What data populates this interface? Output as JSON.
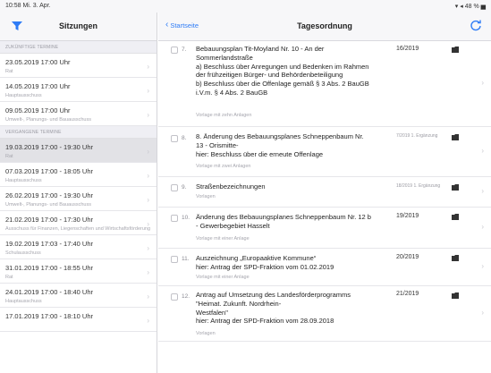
{
  "status_bar": {
    "time": "10:58  Mi. 3. Apr.",
    "right": "▾ ◂ 48 % ▅"
  },
  "sidebar": {
    "title": "Sitzungen",
    "sections": [
      {
        "label": "ZUKÜNFTIGE TERMINE",
        "items": [
          {
            "time": "23.05.2019 17:00 Uhr",
            "body": "Rat",
            "selected": false
          },
          {
            "time": "14.05.2019 17:00 Uhr",
            "body": "Hauptausschuss",
            "selected": false
          },
          {
            "time": "09.05.2019 17:00 Uhr",
            "body": "Umwelt-, Planungs- und Bauausschuss",
            "selected": false
          }
        ]
      },
      {
        "label": "VERGANGENE TERMINE",
        "items": [
          {
            "time": "19.03.2019 17:00 -  19:30 Uhr",
            "body": "Rat",
            "selected": true
          },
          {
            "time": "07.03.2019 17:00 -  18:05 Uhr",
            "body": "Hauptausschuss",
            "selected": false
          },
          {
            "time": "26.02.2019 17:00 -  19:30 Uhr",
            "body": "Umwelt-, Planungs- und Bauausschuss",
            "selected": false
          },
          {
            "time": "21.02.2019 17:00 -  17:30 Uhr",
            "body": "Ausschuss für Finanzen, Liegenschaften und Wirtschaftsförderung",
            "selected": false
          },
          {
            "time": "19.02.2019 17:03 -  17:40 Uhr",
            "body": "Schulausschuss",
            "selected": false
          },
          {
            "time": "31.01.2019 17:00 -  18:55 Uhr",
            "body": "Rat",
            "selected": false
          },
          {
            "time": "24.01.2019 17:00 -  18:40 Uhr",
            "body": "Hauptausschuss",
            "selected": false
          },
          {
            "time": "17.01.2019 17:00 -  18:10 Uhr",
            "body": "",
            "selected": false
          }
        ]
      }
    ]
  },
  "main": {
    "back_label": "Startseite",
    "title": "Tagesordnung",
    "items": [
      {
        "number": "7.",
        "title": "Bebauungsplan Tit-Moyland Nr. 10 - An der Sommerlandstraße\na) Beschluss über Anregungen und Bedenken im Rahmen der frühzeitigen Bürger- und Behördenbeteiligung\nb) Beschluss über die Offenlage gemäß § 3 Abs. 2 BauGB i.V.m. § 4 Abs. 2 BauGB",
        "sub": "Vorlage mit zehn Anlagen",
        "ref": "16/2019",
        "ref_small": false
      },
      {
        "number": "8.",
        "title": "8. Änderung des Bebauungsplanes Schneppenbaum Nr. 13 - Orismitte-\nhier: Beschluss über die erneute Offenlage",
        "sub": "Vorlage mit zwei Anlagen",
        "ref": "7/2019 1. Ergänzung",
        "ref_small": true
      },
      {
        "number": "9.",
        "title": "Straßenbezeichnungen",
        "sub": "Vorlagen",
        "ref": "18/2019 1. Ergänzung",
        "ref_small": true
      },
      {
        "number": "10.",
        "title": "Änderung des Bebauungsplanes Schneppenbaum Nr. 12 b - Gewerbegebiet Hasselt",
        "sub": "Vorlage mit einer Anlage",
        "ref": "19/2019",
        "ref_small": false
      },
      {
        "number": "11.",
        "title": "Auszeichnung „Europaaktive Kommune“\nhier: Antrag der SPD-Fraktion vom 01.02.2019",
        "sub": "Vorlage mit einer Anlage",
        "ref": "20/2019",
        "ref_small": false
      },
      {
        "number": "12.",
        "title": "Antrag auf Umsetzung des Landesförderprogramms \"Heimat. Zukunft. Nordrhein-\nWestfalen\"\nhier: Antrag der SPD-Fraktion vom 28.09.2018",
        "sub": "Vorlagen",
        "ref": "21/2019",
        "ref_small": false
      }
    ]
  },
  "colors": {
    "accent": "#2f7cf6",
    "selected_row": "#e2e2e6",
    "section_bg": "#efeff4"
  },
  "icons": {
    "filter": "filter-icon",
    "refresh": "refresh-icon",
    "document": "document-icon",
    "chevron": "chevron-right-icon"
  }
}
